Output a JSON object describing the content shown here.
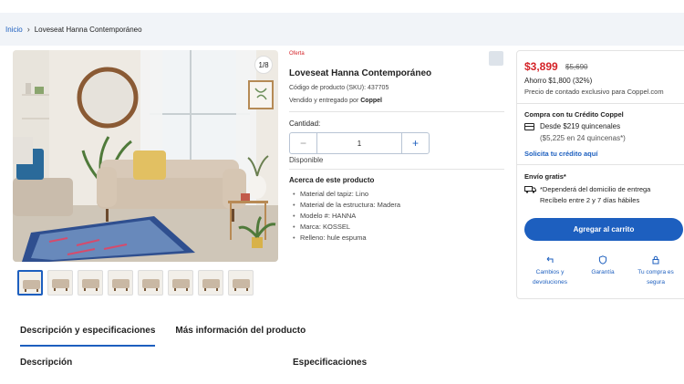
{
  "breadcrumb": {
    "home": "Inicio",
    "current": "Loveseat Hanna Contemporáneo"
  },
  "gallery": {
    "counter": "1/8",
    "thumb_count": 8
  },
  "product": {
    "badge": "Oferta",
    "title": "Loveseat Hanna Contemporáneo",
    "sku": "Código de producto (SKU): 437705",
    "seller_prefix": "Vendido y entregado por",
    "seller_name": "Coppel"
  },
  "quantity": {
    "label": "Cantidad:",
    "value": "1",
    "minus": "−",
    "plus": "+",
    "status": "Disponible"
  },
  "about": {
    "title": "Acerca de este producto",
    "features": [
      "Material del tapiz: Lino",
      "Material de la estructura: Madera",
      "Modelo #: HANNA",
      "Marca: KOSSEL",
      "Relleno: hule espuma"
    ]
  },
  "buybox": {
    "price": "$3,899",
    "old_price": "$5,690",
    "savings": "Ahorro $1,800 (32%)",
    "cash_note": "Precio de contado exclusivo para Coppel.com",
    "credit_title": "Compra con tu Crédito Coppel",
    "credit_from": "Desde $219 quincenales",
    "credit_total": "($5,225 en 24 quincenas*)",
    "credit_link": "Solicita tu crédito aquí",
    "shipping_title": "Envío gratis*",
    "shipping_note": "*Dependerá del domicilio de entrega",
    "shipping_eta": "Recíbelo entre 2 y 7 días hábiles",
    "cart_button": "Agregar al carrito",
    "services": {
      "returns_1": "Cambios y",
      "returns_2": "devoluciones",
      "warranty": "Garantía",
      "secure_1": "Tu compra es",
      "secure_2": "segura"
    }
  },
  "tabs": [
    "Descripción y especificaciones",
    "Más información del producto"
  ],
  "sections": {
    "description": "Descripción",
    "specs": "Especificaciones"
  },
  "colors": {
    "accent": "#1d5fbf",
    "price_red": "#d42328"
  }
}
